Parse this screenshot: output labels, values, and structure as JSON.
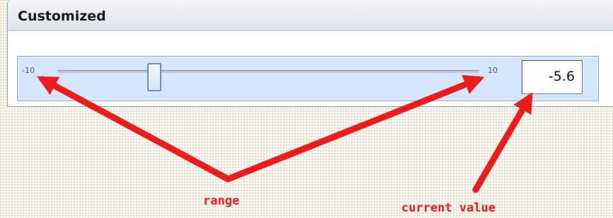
{
  "panel": {
    "title": "Customized"
  },
  "slider": {
    "min_label": "-10",
    "max_label": "10",
    "current_value": "-5.6",
    "min": -10,
    "max": 10,
    "value": -5.6
  },
  "annotations": {
    "range_label": "range",
    "current_value_label": "current value",
    "color": "#ee1b1b"
  }
}
